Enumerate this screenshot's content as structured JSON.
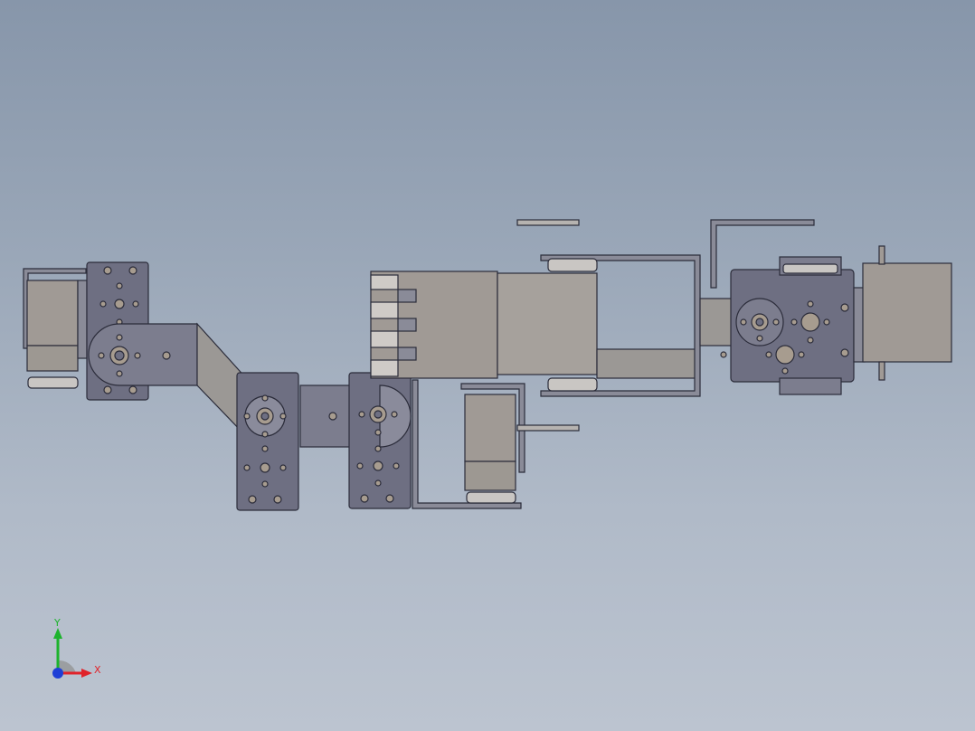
{
  "viewport": {
    "background_top": "#8796aa",
    "background_bottom": "#bcc4d0"
  },
  "model": {
    "description_icon": "robot-arm-assembly-icon",
    "colors": {
      "bracket": "#6e6f82",
      "bracket_edge": "#2b2c3a",
      "servo_body": "#a09a95",
      "servo_light": "#c9c6c3",
      "hole": "#9a8e80",
      "link": "#9b9895"
    }
  },
  "triad": {
    "x_label": "X",
    "y_label": "Y",
    "colors": {
      "x": "#e0232a",
      "y": "#1db32d",
      "z": "#1f3fd6"
    }
  }
}
